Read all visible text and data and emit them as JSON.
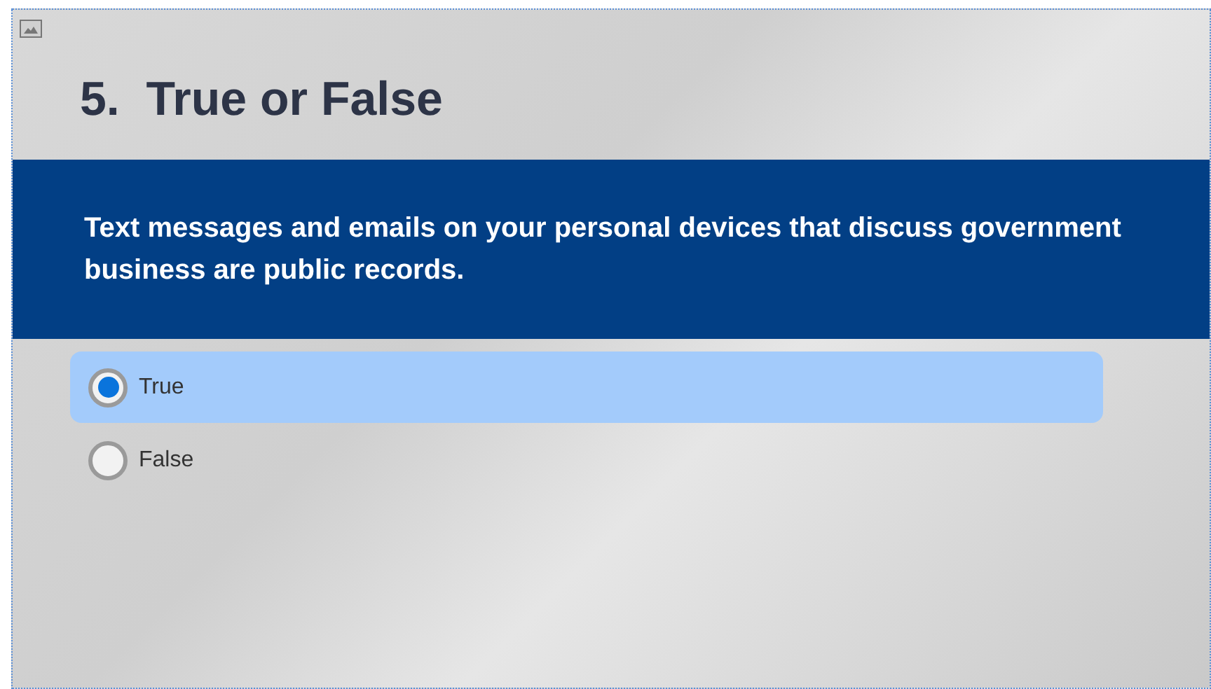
{
  "title": "5.  True or False",
  "question": "Text messages and emails on your personal devices that discuss government business are public records.",
  "options": [
    {
      "label": "True",
      "selected": true
    },
    {
      "label": "False",
      "selected": false
    }
  ]
}
